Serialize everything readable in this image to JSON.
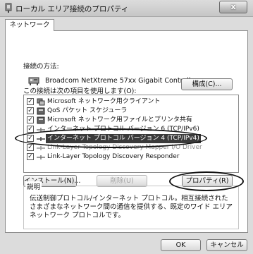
{
  "window": {
    "title": "ローカル エリア接続のプロパティ",
    "close_label": "x"
  },
  "tabs": [
    {
      "label": "ネットワーク"
    }
  ],
  "connect_using": {
    "label": "接続の方法:",
    "adapter_name": "Broadcom NetXtreme 57xx Gigabit Controller",
    "configure_button": "構成(C)..."
  },
  "items_list": {
    "label": "この接続は次の項目を使用します(O):",
    "items": [
      {
        "label": "Microsoft ネットワーク用クライアント",
        "checked": true
      },
      {
        "label": "QoS パケット スケジューラ",
        "checked": true
      },
      {
        "label": "Microsoft ネットワーク用ファイルとプリンタ共有",
        "checked": true
      },
      {
        "label": "インターネット プロトコル バージョン 6 (TCP/IPv6)",
        "checked": true
      },
      {
        "label": "インターネット プロトコル バージョン 4 (TCP/IPv4)",
        "checked": true
      },
      {
        "label": "Link-Layer Topology Discovery Mapper I/O Driver",
        "checked": true
      },
      {
        "label": "Link-Layer Topology Discovery Responder",
        "checked": true
      }
    ]
  },
  "buttons": {
    "install": "インストール(N)...",
    "uninstall": "削除(U)",
    "properties": "プロパティ(R)"
  },
  "description": {
    "label": "説明",
    "text": "伝送制御プロトコル/インターネット プロトコル。相互接続されたさまざまなネットワーク間の通信を提供する、既定のワイド エリア ネットワーク プロトコルです。"
  },
  "footer": {
    "ok": "OK",
    "cancel": "キャンセル"
  }
}
